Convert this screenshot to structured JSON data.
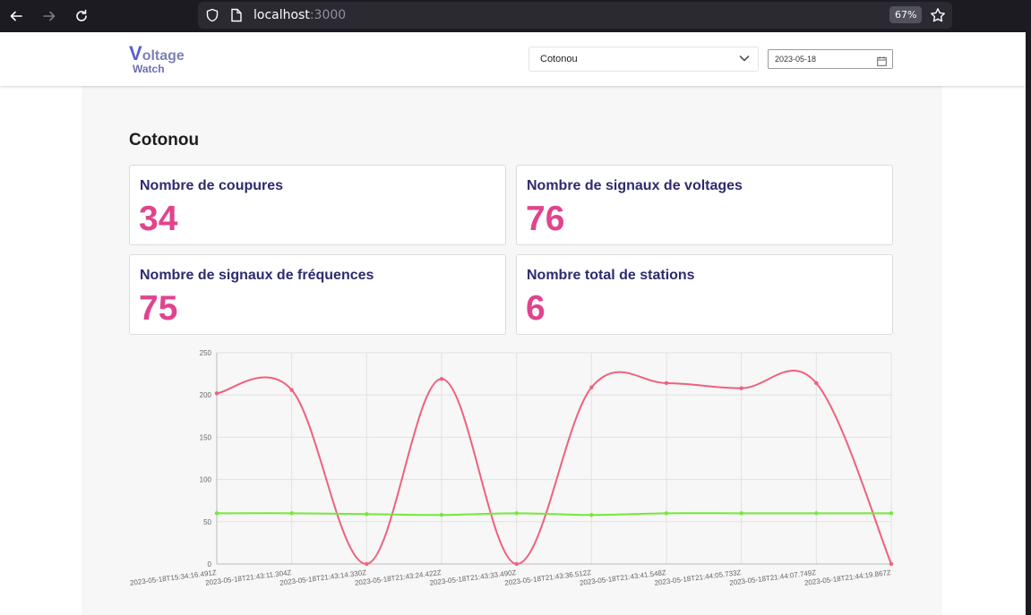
{
  "browser": {
    "url_host": "localhost",
    "url_port": ":3000",
    "zoom": "67%",
    "icons": [
      "back-arrow-icon",
      "forward-arrow-icon",
      "reload-icon",
      "shield-icon",
      "page-icon",
      "star-icon"
    ]
  },
  "header": {
    "logo_first_letter": "V",
    "logo_rest": "oltage",
    "logo_second": "Watch",
    "city_select_value": "Cotonou",
    "date_value": "2023-05-18"
  },
  "main": {
    "title": "Cotonou",
    "cards": [
      {
        "label": "Nombre de coupures",
        "value": "34"
      },
      {
        "label": "Nombre de signaux de voltages",
        "value": "76"
      },
      {
        "label": "Nombre de signaux de fréquences",
        "value": "75"
      },
      {
        "label": "Nombre total de stations",
        "value": "6"
      }
    ]
  },
  "colors": {
    "accent_value": "#e0448d",
    "card_label": "#2e2a6e",
    "voltage_series": "#f0607e",
    "frequency_series": "#74e83a"
  },
  "chart_data": {
    "type": "line",
    "x": [
      "2023-05-18T15:34:16.491Z",
      "2023-05-18T21:43:11.304Z",
      "2023-05-18T21:43:14.330Z",
      "2023-05-18T21:43:24.422Z",
      "2023-05-18T21:43:33.490Z",
      "2023-05-18T21:43:36.512Z",
      "2023-05-18T21:43:41.548Z",
      "2023-05-18T21:44:05.733Z",
      "2023-05-18T21:44:07.749Z",
      "2023-05-18T21:44:19.867Z"
    ],
    "series": [
      {
        "values": [
          202,
          206,
          0,
          219,
          0,
          209,
          214,
          208,
          214,
          0
        ],
        "color": "#f0607e"
      },
      {
        "values": [
          60,
          60,
          59,
          58,
          60,
          58,
          60,
          60,
          60,
          60
        ],
        "color": "#74e83a"
      }
    ],
    "ylim": [
      0,
      250
    ],
    "yticks": [
      0,
      50,
      100,
      150,
      200,
      250
    ],
    "grid": true
  }
}
